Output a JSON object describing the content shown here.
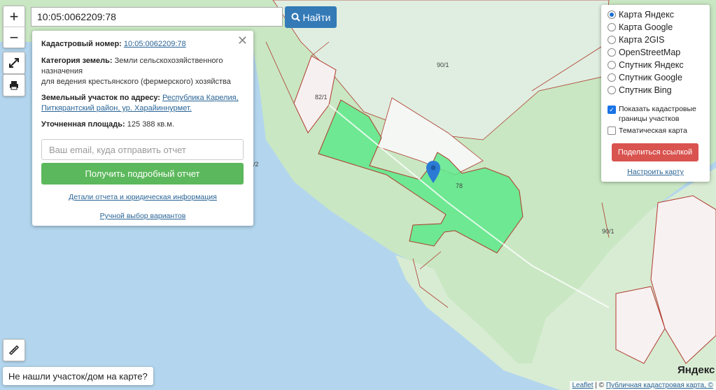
{
  "search": {
    "value": "10:05:0062209:78",
    "button_label": "Найти"
  },
  "zoom": {
    "in": "+",
    "out": "−"
  },
  "popup": {
    "cadastral_label": "Кадастровый номер:",
    "cadastral_value": "10:05:0062209:78",
    "category_label": "Категория земель:",
    "category_value_1": "Земли сельскохозяйственного",
    "category_value_2": "назначения",
    "category_value_3": "для ведения крестьянского (фермерского) хозяйства",
    "address_label": "Земельный участок по адресу:",
    "address_value_1": "Республика Карелия,",
    "address_value_2": "Питкярантский район, ур. Харайиннурмет.",
    "area_label": "Уточненная площадь:",
    "area_value": "125 388 кв.м.",
    "email_placeholder": "Ваш email, куда отправить отчет",
    "report_button": "Получить подробный отчет",
    "details_link": "Детали отчета и юридическая информация",
    "manual_link": "Ручной выбор вариантов"
  },
  "layers": {
    "options": [
      {
        "label": "Карта Яндекс",
        "selected": true
      },
      {
        "label": "Карта Google",
        "selected": false
      },
      {
        "label": "Карта 2GIS",
        "selected": false
      },
      {
        "label": "OpenStreetMap",
        "selected": false
      },
      {
        "label": "Спутник Яндекс",
        "selected": false
      },
      {
        "label": "Спутник Google",
        "selected": false
      },
      {
        "label": "Спутник Bing",
        "selected": false
      }
    ],
    "show_borders_1": "Показать кадастровые",
    "show_borders_2": "границы участков",
    "show_borders_checked": true,
    "thematic_label": "Тематическая карта",
    "thematic_checked": false,
    "share_button": "Поделиться ссылкой",
    "configure_link": "Настроить карту"
  },
  "map_labels": {
    "l1": "90/1",
    "l2": "82/1",
    "l3": "78",
    "l4": "90/1",
    "l5": "/2"
  },
  "not_found": "Не нашли участок/дом на карте?",
  "attribution": {
    "leaflet": "Leaflet",
    "sep": " | © ",
    "rest": "Публичная кадастровая карта, ©"
  },
  "yandex_logo": "Яндекс",
  "colors": {
    "parcel_fill": "#5ee88a",
    "parcel_border": "#b03a2e",
    "land": "#c9e7c3",
    "water": "#b3d6ee",
    "marker": "#2b7bd4"
  }
}
